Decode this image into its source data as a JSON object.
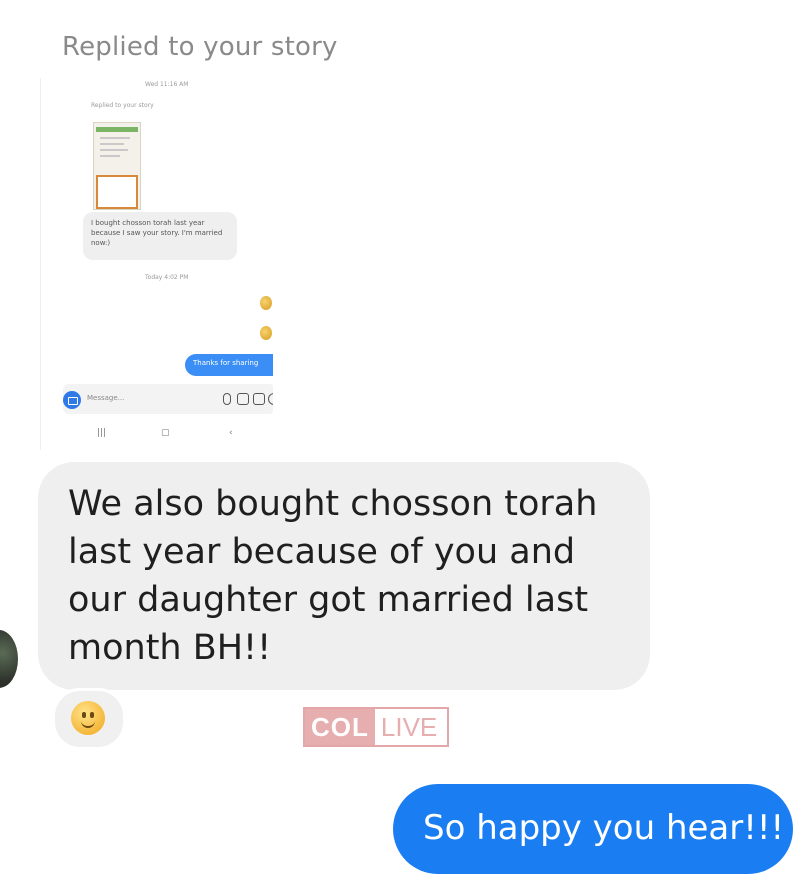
{
  "story_reply": {
    "label": "Replied to your story",
    "screenshot": {
      "time_1": "Wed 11:16 AM",
      "replied_label": "Replied to your story",
      "message": "I bought chosson torah last year because I saw your story. I'm married now:)",
      "time_2": "Today 4:02 PM",
      "reply": "Thanks for sharing",
      "composer_placeholder": "Message...",
      "nav_icons": [
        "recents-icon",
        "home-icon",
        "back-icon"
      ]
    }
  },
  "conversation": {
    "received_message": "We also bought chosson torah last year because of you and our daughter got married last month BH!!",
    "reaction": "slightly-smiling-face-emoji",
    "sent_message": "So happy you hear!!!"
  },
  "watermark": {
    "part1": "COL",
    "part2": "LIVE"
  },
  "colors": {
    "sent_bubble": "#1a7ef2",
    "received_bubble": "#efefef",
    "watermark": "#e7aeb0"
  }
}
